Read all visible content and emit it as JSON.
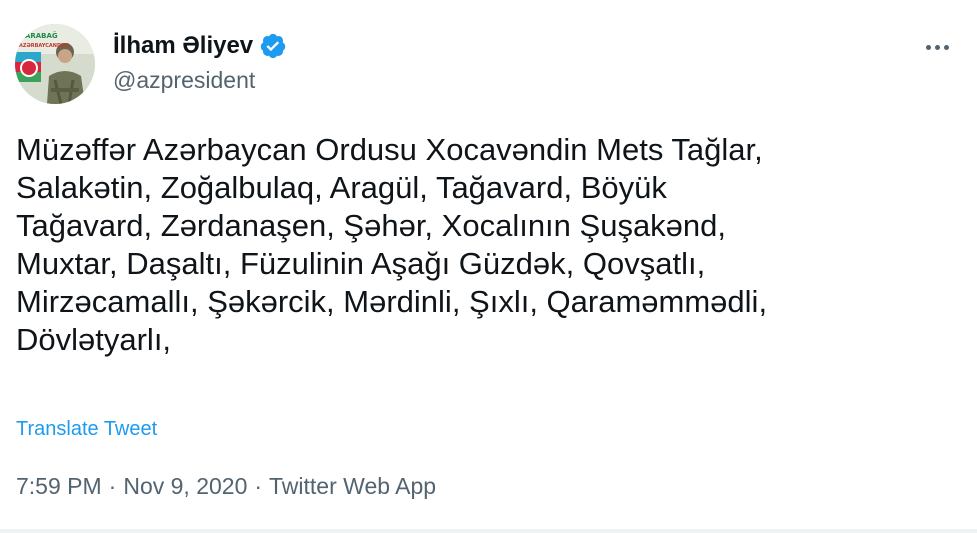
{
  "user": {
    "display_name": "İlham Əliyev",
    "handle": "@azpresident",
    "avatar_text": "QARABAĞ AZƏRBAYCANDIR!"
  },
  "tweet": {
    "lines": [
      "Müzəffər Azərbaycan Ordusu Xocavəndin Mets Tağlar,",
      "Salakətin, Zoğalbulaq, Aragül, Tağavard, Böyük",
      "Tağavard, Zərdanaşen, Şəhər, Xocalının Şuşakənd,",
      "Muxtar, Daşaltı, Füzulinin Aşağı Güzdək, Qovşatlı,",
      "Mirzəcamallı, Şəkərcik, Mərdinli, Şıxlı, Qaraməmmədli,",
      "Dövlətyarlı,"
    ],
    "translate_label": "Translate Tweet"
  },
  "meta": {
    "time": "7:59 PM",
    "date": "Nov 9, 2020",
    "separator": "·",
    "source": "Twitter Web App"
  },
  "icons": {
    "verified": "verified-badge-icon",
    "more": "more-options-icon"
  },
  "colors": {
    "link": "#1d9bf0",
    "secondary_text": "#536471",
    "primary_text": "#0f1419",
    "verified": "#1d9bf0"
  }
}
